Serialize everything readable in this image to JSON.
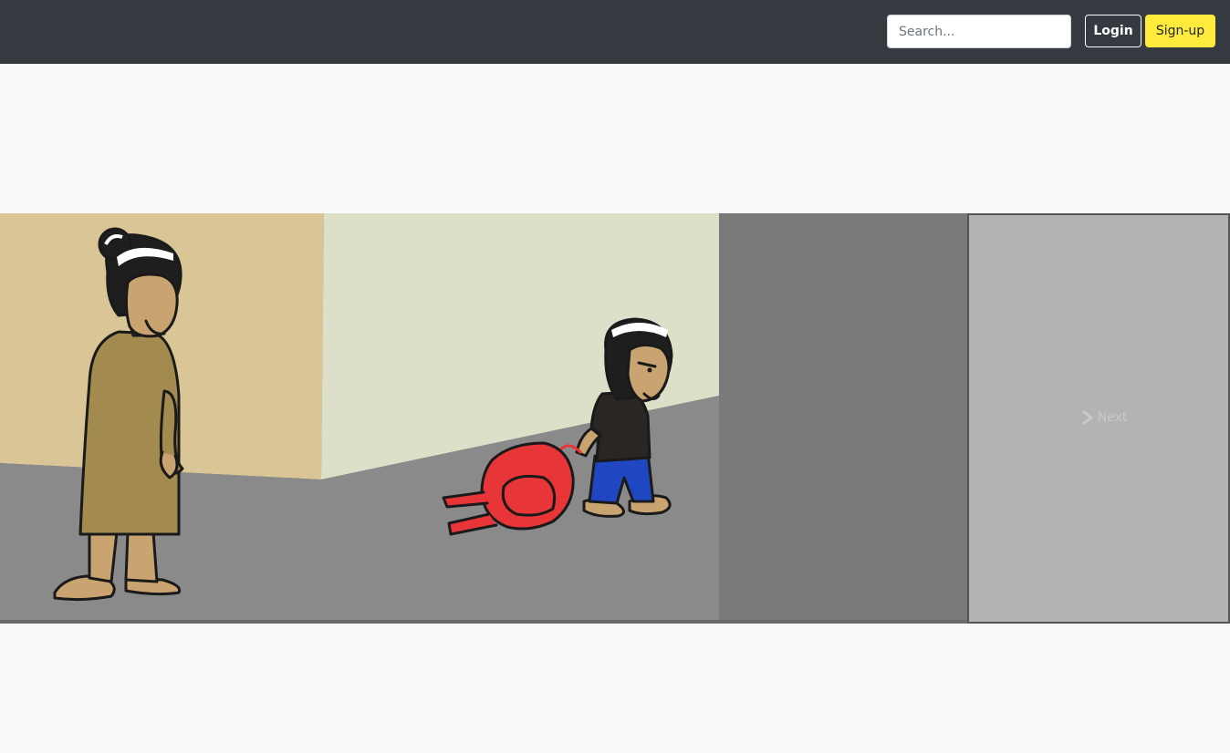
{
  "navbar": {
    "search": {
      "placeholder": "Search..."
    },
    "login_label": "Login",
    "signup_label": "Sign-up"
  },
  "comic": {
    "next_label": "Next",
    "next_icon": "chevron-right-icon"
  },
  "colors": {
    "navbar_bg": "#343a40",
    "page_bg": "#f8f9fa",
    "signup_bg": "#ffeb3b",
    "next_panel_bg": "#b3b3b3",
    "strip_bg": "#7a7a7a"
  }
}
